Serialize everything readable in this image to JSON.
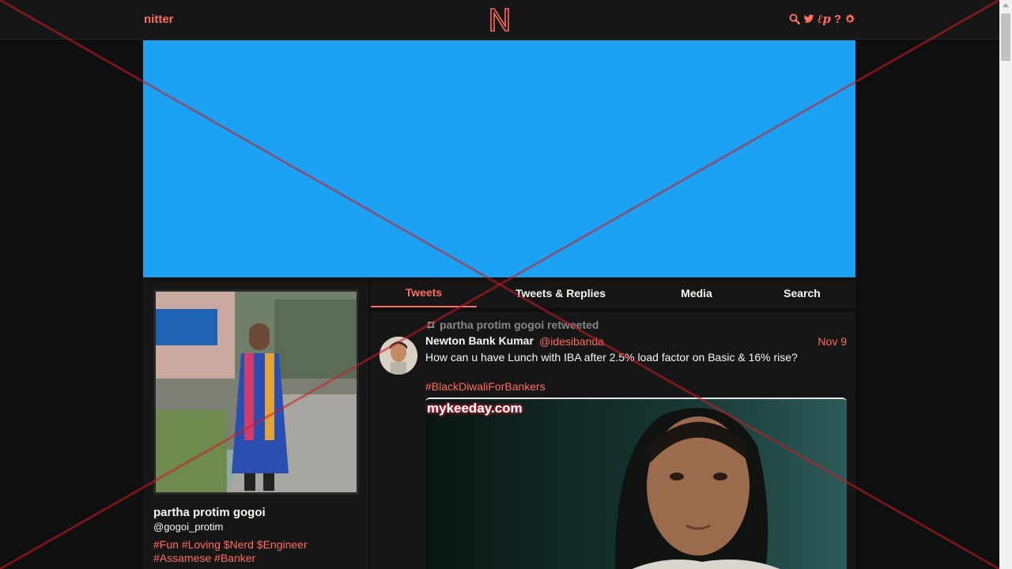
{
  "navbar": {
    "brand": "nitter",
    "logo_letter": "N",
    "icons": [
      "search-icon",
      "twitter-bird-icon",
      "rss-icon",
      "help-icon",
      "gear-icon"
    ],
    "rss_glyph": "ℓp",
    "help_glyph": "?"
  },
  "profile": {
    "name": "partha protim gogoi",
    "handle": "@gogoi_protim",
    "bio_line1": [
      "#Fun",
      "#Loving",
      "$Nerd",
      "$Engineer"
    ],
    "bio_line2": [
      "#Assamese",
      "#Banker"
    ]
  },
  "tabs": [
    {
      "label": "Tweets",
      "active": true
    },
    {
      "label": "Tweets & Replies",
      "active": false
    },
    {
      "label": "Media",
      "active": false
    },
    {
      "label": "Search",
      "active": false
    }
  ],
  "tweet": {
    "retweet_header": "partha protim gogoi retweeted",
    "fullname": "Newton Bank Kumar",
    "username": "@idesibanda",
    "date": "Nov 9",
    "text": "How can u have Lunch with IBA after 2.5% load factor on Basic & 16% rise?",
    "hashtag": "#BlackDiwaliForBankers",
    "media_watermark": "mykeeday.com"
  },
  "colors": {
    "accent": "#ff6c60",
    "banner": "#1da1f2",
    "background": "#0f0f0f",
    "panel": "#161616"
  }
}
